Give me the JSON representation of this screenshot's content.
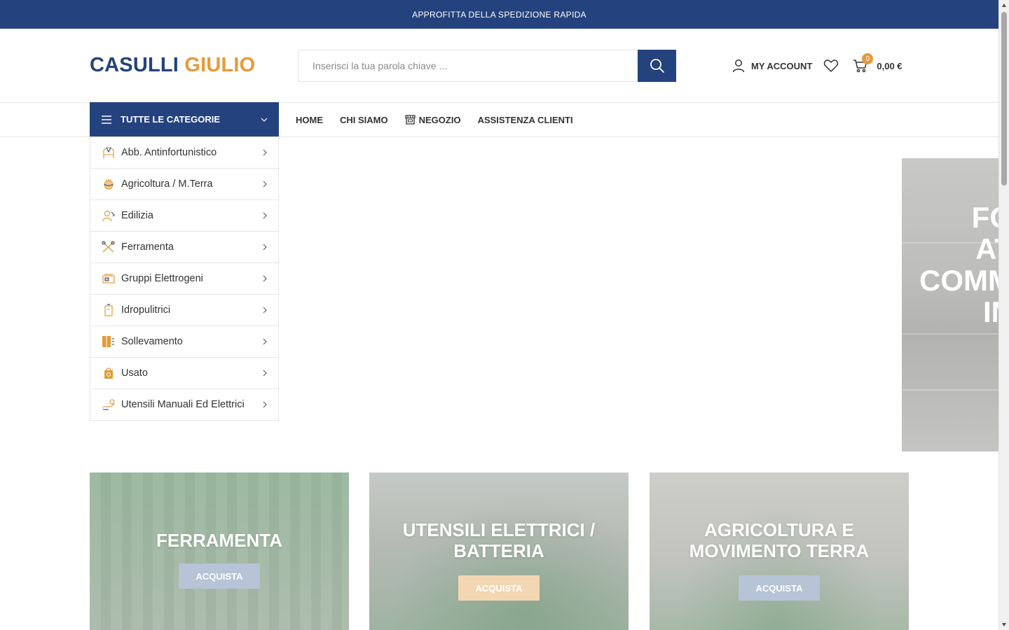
{
  "topbar": {
    "text": "APPROFITTA DELLA SPEDIZIONE RAPIDA"
  },
  "logo": {
    "part1": "CASULLI",
    "part2": "GIULIO"
  },
  "search": {
    "placeholder": "Inserisci la tua parola chiave ..."
  },
  "account": {
    "label": "MY ACCOUNT"
  },
  "cart": {
    "count": "0",
    "total": "0,00 €"
  },
  "categories_button": {
    "label": "TUTTE LE CATEGORIE"
  },
  "nav": [
    {
      "label": "HOME"
    },
    {
      "label": "CHI SIAMO"
    },
    {
      "label": "NEGOZIO"
    },
    {
      "label": "ASSISTENZA CLIENTI"
    }
  ],
  "categories": [
    {
      "label": "Abb. Antinfortunistico",
      "icon": "safety-clothing-icon"
    },
    {
      "label": "Agricoltura / M.Terra",
      "icon": "agriculture-icon"
    },
    {
      "label": "Edilizia",
      "icon": "construction-icon"
    },
    {
      "label": "Ferramenta",
      "icon": "tools-icon"
    },
    {
      "label": "Gruppi Elettrogeni",
      "icon": "generator-icon"
    },
    {
      "label": "Idropulitrici",
      "icon": "pressure-washer-icon"
    },
    {
      "label": "Sollevamento",
      "icon": "lifting-icon"
    },
    {
      "label": "Usato",
      "icon": "used-bag-icon"
    },
    {
      "label": "Utensili Manuali Ed Elettrici",
      "icon": "hand-tools-icon"
    }
  ],
  "hero": {
    "lines": [
      "FO",
      "AT",
      "COMM",
      "IN"
    ]
  },
  "banners": [
    {
      "title": "FERRAMENTA",
      "button": "ACQUISTA"
    },
    {
      "title": "UTENSILI ELETTRICI / BATTERIA",
      "button": "ACQUISTA"
    },
    {
      "title": "AGRICOLTURA E MOVIMENTO TERRA",
      "button": "ACQUISTA"
    }
  ],
  "colors": {
    "brand_blue": "#24427d",
    "brand_orange": "#e59a3a"
  }
}
